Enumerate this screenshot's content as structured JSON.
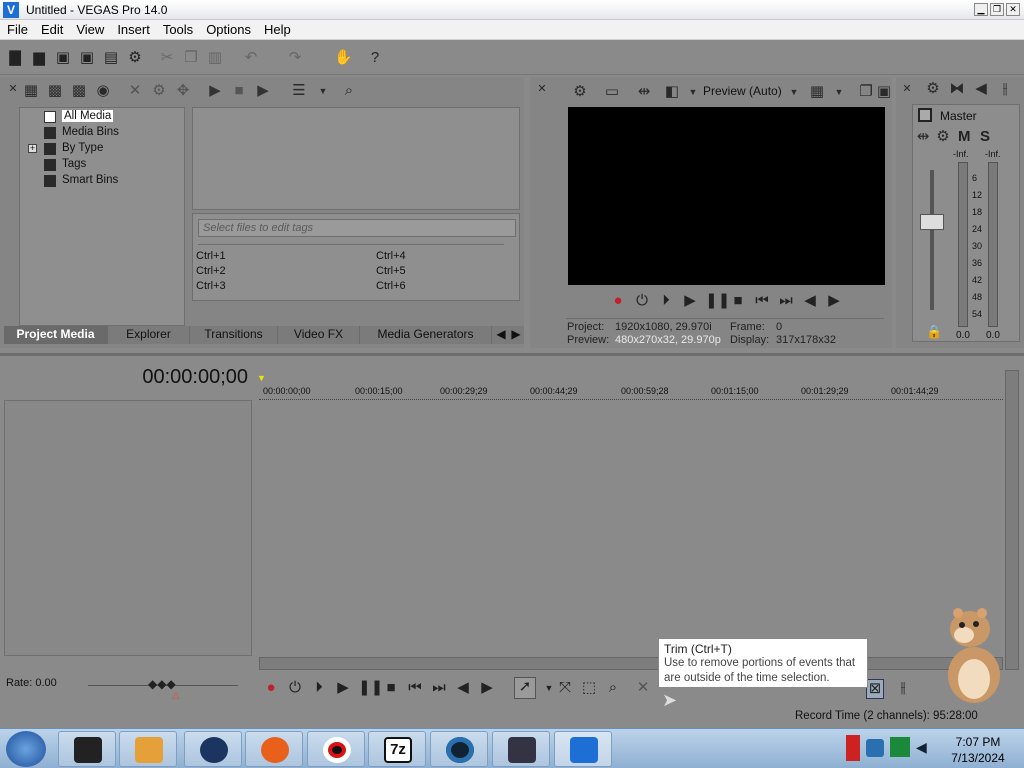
{
  "window": {
    "title": "Untitled - VEGAS Pro 14.0",
    "logo": "V"
  },
  "menu": [
    "File",
    "Edit",
    "View",
    "Insert",
    "Tools",
    "Options",
    "Help"
  ],
  "project_media": {
    "tree": [
      "All Media",
      "Media Bins",
      "By Type",
      "Tags",
      "Smart Bins"
    ],
    "tag_placeholder": "Select files to edit tags",
    "shortcuts": [
      "Ctrl+1",
      "Ctrl+2",
      "Ctrl+3",
      "Ctrl+4",
      "Ctrl+5",
      "Ctrl+6"
    ]
  },
  "tabs": [
    "Project Media",
    "Explorer",
    "Transitions",
    "Video FX",
    "Media Generators"
  ],
  "preview": {
    "mode": "Preview (Auto)",
    "project_label": "Project:",
    "project_value": "1920x1080, 29.970i",
    "preview_label": "Preview:",
    "preview_value": "480x270x32, 29.970p",
    "frame_label": "Frame:",
    "frame_value": "0",
    "display_label": "Display:",
    "display_value": "317x178x32"
  },
  "master": {
    "label": "Master",
    "m": "M",
    "s": "S",
    "inf_left": "-Inf.",
    "inf_right": "-Inf.",
    "scale": [
      "6",
      "12",
      "18",
      "24",
      "30",
      "36",
      "42",
      "48",
      "54"
    ],
    "val_left": "0.0",
    "val_right": "0.0"
  },
  "timeline": {
    "timecode": "00:00:00;00",
    "ruler": [
      "00:00:00;00",
      "00:00:15;00",
      "00:00:29;29",
      "00:00:44;29",
      "00:00:59;28",
      "00:01:15;00",
      "00:01:29;29",
      "00:01:44;29"
    ],
    "rate": "Rate: 0.00"
  },
  "tooltip": {
    "title": "Trim (Ctrl+T)",
    "line1": "Use to remove portions of events that",
    "line2": "are outside of the time selection."
  },
  "status": {
    "record_time": "Record Time (2 channels): 95:28:00"
  },
  "taskbar": {
    "time": "7:07 PM",
    "date": "7/13/2024",
    "app7z": "7z"
  },
  "colors": {
    "accent": "#1d6fd6",
    "record": "#c0202a"
  }
}
